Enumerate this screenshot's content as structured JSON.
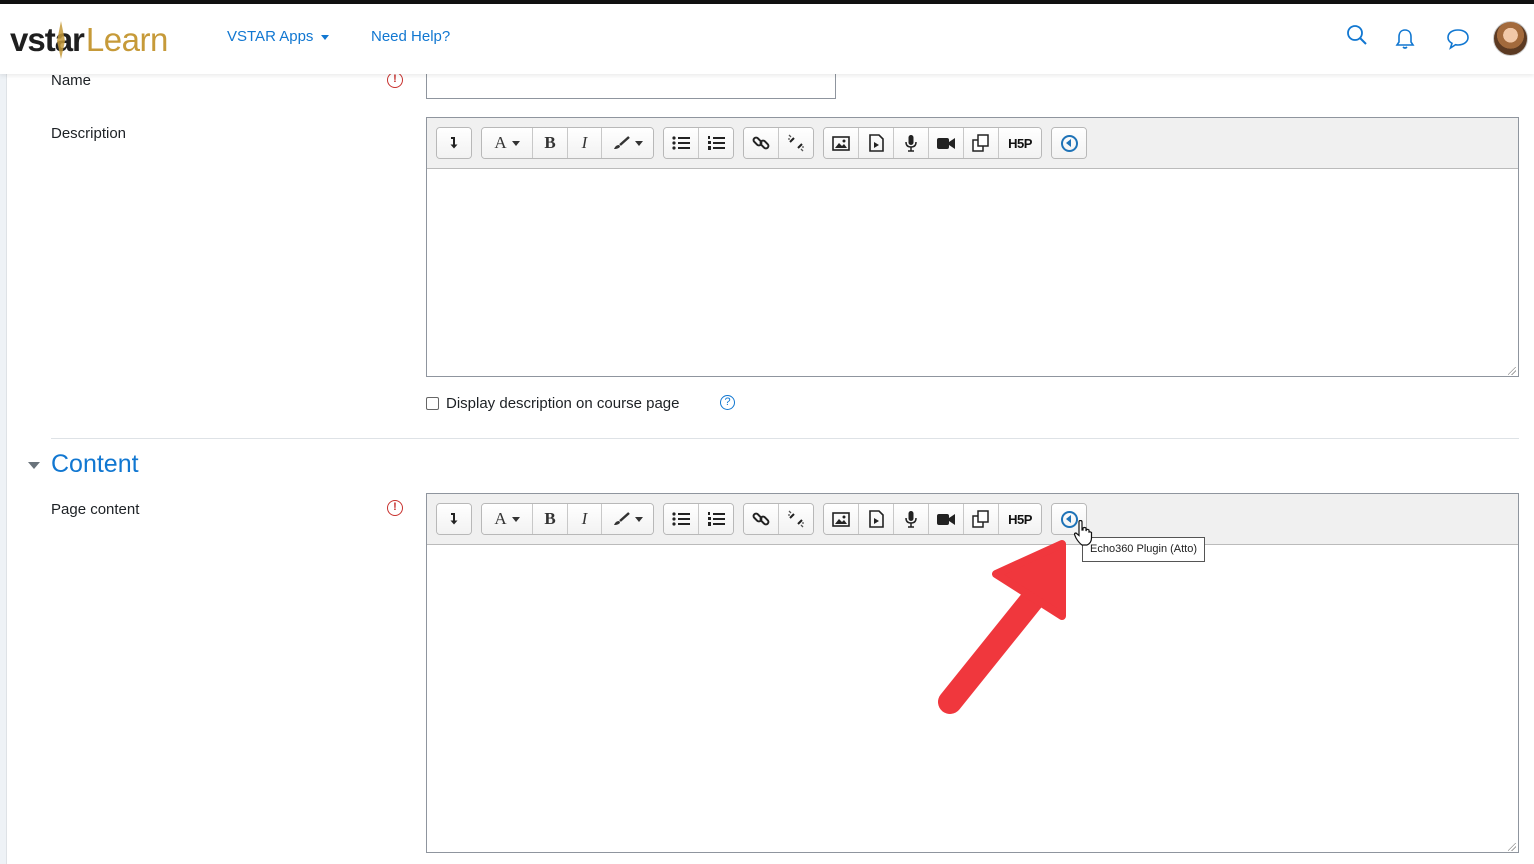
{
  "brand": {
    "logo_prefix": "vs",
    "logo_middle": "tar",
    "logo_suffix": "Learn"
  },
  "nav": {
    "apps_label": "VSTAR Apps",
    "help_label": "Need Help?",
    "icons": [
      "search-icon",
      "bell-icon",
      "chat-icon",
      "avatar"
    ]
  },
  "form": {
    "name_label": "Name",
    "description_label": "Description",
    "required_mark": "!",
    "display_description_label": "Display description on course page",
    "help_mark": "?",
    "content_section_title": "Content",
    "page_content_label": "Page content"
  },
  "toolbar": {
    "font_label": "A",
    "bold_label": "B",
    "italic_label": "I",
    "h5p_label": "H5P",
    "buttons": [
      "collapse",
      "paragraph-style",
      "bold",
      "italic",
      "clear-format",
      "unordered-list",
      "ordered-list",
      "link",
      "unlink",
      "image",
      "media",
      "record-audio",
      "record-video",
      "manage-files",
      "h5p",
      "echo360"
    ]
  },
  "tooltip": {
    "text": "Echo360 Plugin (Atto)"
  },
  "colors": {
    "accent": "#1177d1",
    "brand_gold": "#c69a39",
    "required": "#c8322f",
    "annotation_arrow": "#f0373d"
  }
}
